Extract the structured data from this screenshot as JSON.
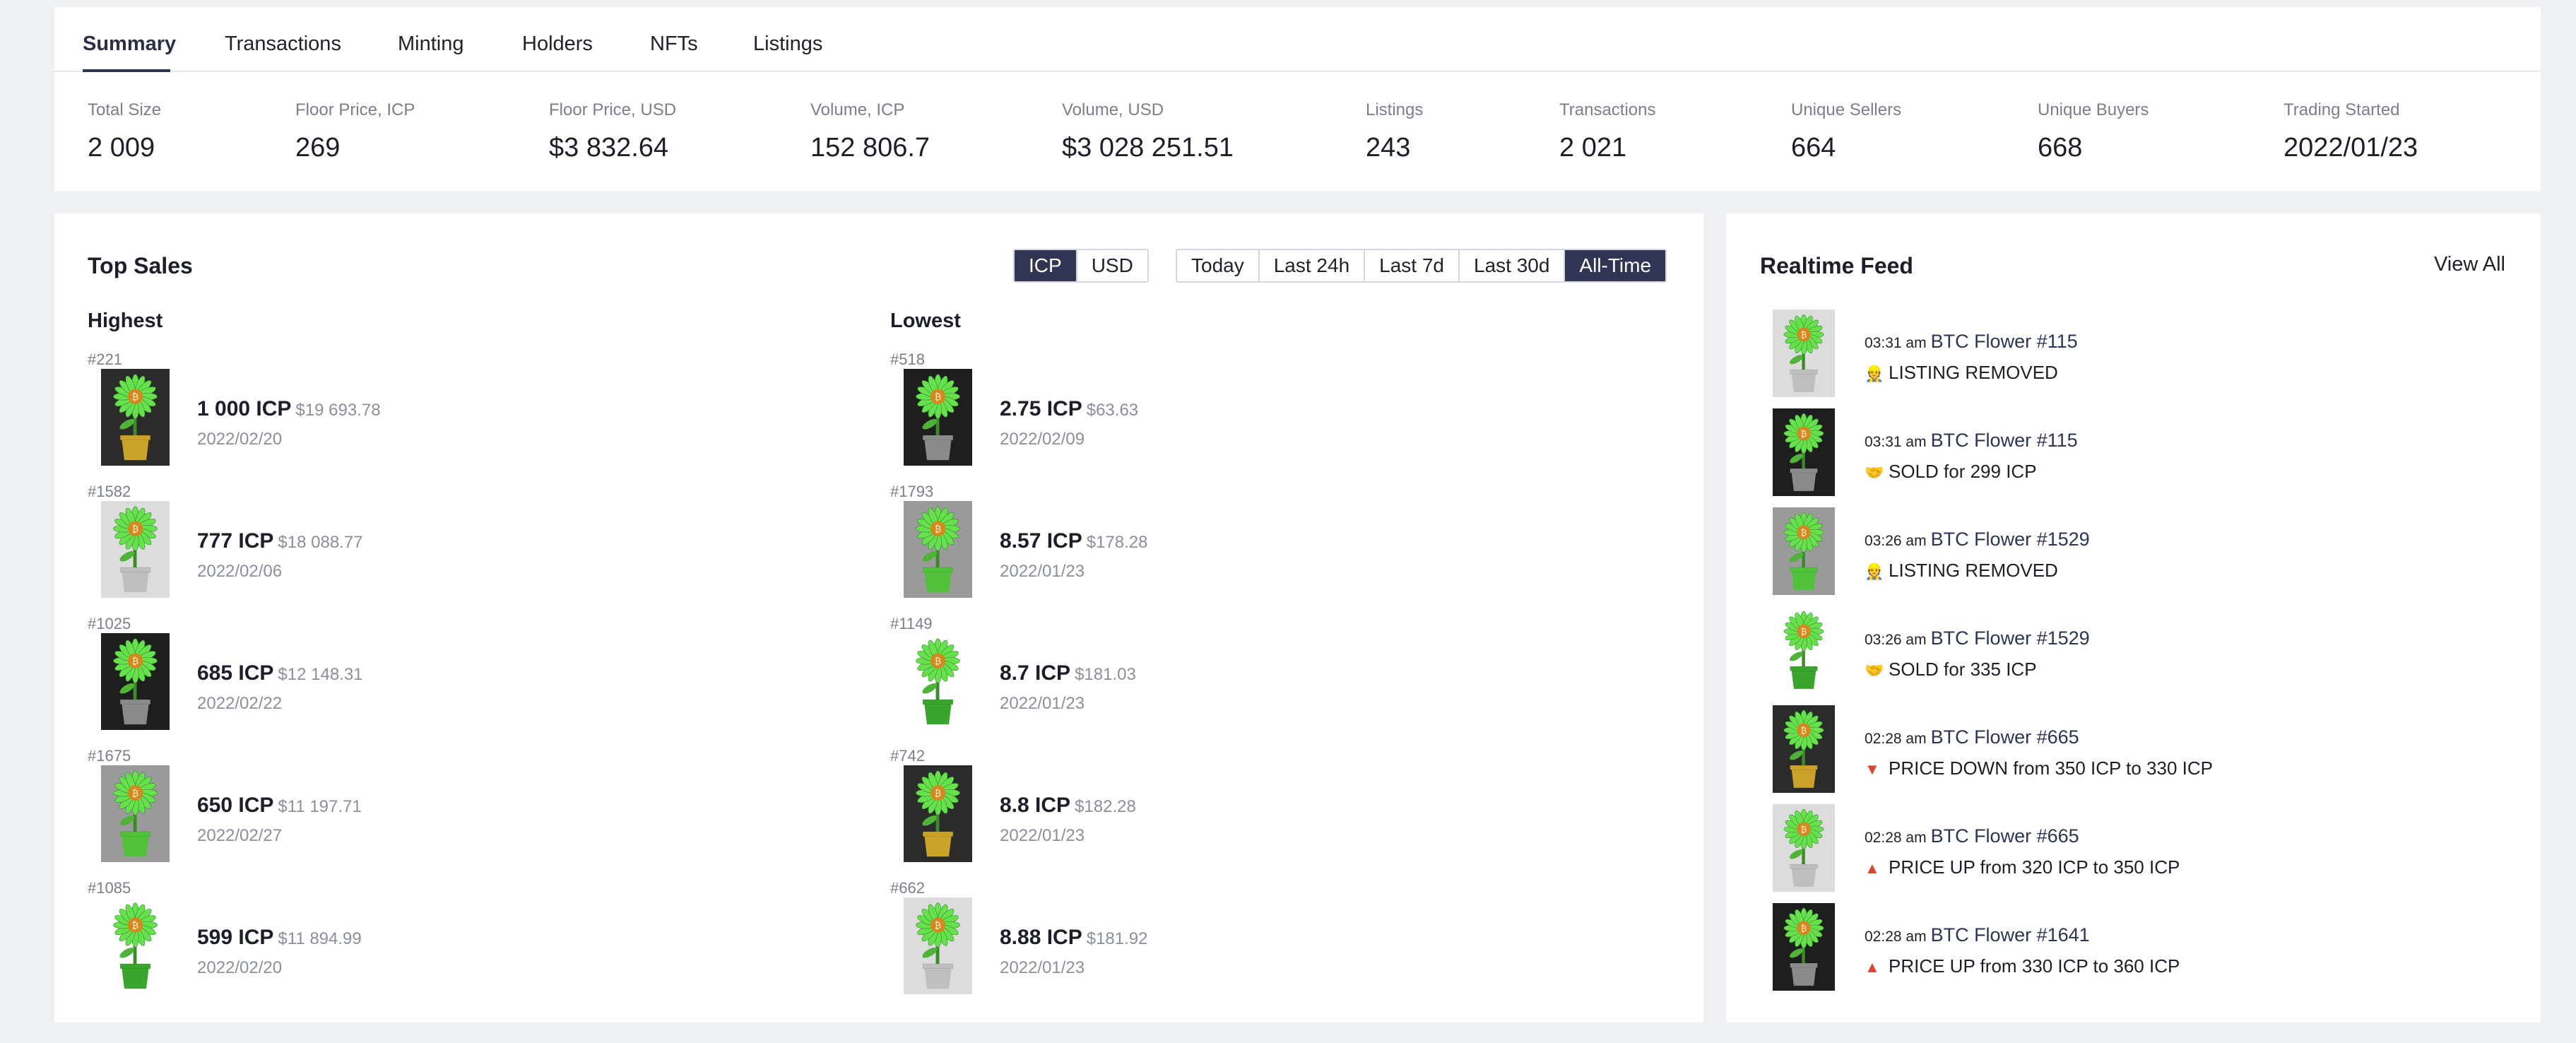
{
  "tabs": [
    {
      "label": "Summary",
      "active": true
    },
    {
      "label": "Transactions"
    },
    {
      "label": "Minting"
    },
    {
      "label": "Holders"
    },
    {
      "label": "NFTs"
    },
    {
      "label": "Listings"
    }
  ],
  "stats": [
    {
      "label": "Total Size",
      "value": "2 009"
    },
    {
      "label": "Floor Price, ICP",
      "value": "269"
    },
    {
      "label": "Floor Price, USD",
      "value": "$3 832.64"
    },
    {
      "label": "Volume, ICP",
      "value": "152 806.7"
    },
    {
      "label": "Volume, USD",
      "value": "$3 028 251.51"
    },
    {
      "label": "Listings",
      "value": "243"
    },
    {
      "label": "Transactions",
      "value": "2 021"
    },
    {
      "label": "Unique Sellers",
      "value": "664"
    },
    {
      "label": "Unique Buyers",
      "value": "668"
    },
    {
      "label": "Trading Started",
      "value": "2022/01/23"
    }
  ],
  "top_sales": {
    "title": "Top Sales",
    "currency_options": [
      "ICP",
      "USD"
    ],
    "currency_selected": "ICP",
    "period_options": [
      "Today",
      "Last 24h",
      "Last 7d",
      "Last 30d",
      "All-Time"
    ],
    "period_selected": "All-Time",
    "highest_label": "Highest",
    "lowest_label": "Lowest",
    "highest": [
      {
        "id": "#221",
        "price": "1 000 ICP",
        "usd": "$19 693.78",
        "date": "2022/02/20"
      },
      {
        "id": "#1582",
        "price": "777 ICP",
        "usd": "$18 088.77",
        "date": "2022/02/06"
      },
      {
        "id": "#1025",
        "price": "685 ICP",
        "usd": "$12 148.31",
        "date": "2022/02/22"
      },
      {
        "id": "#1675",
        "price": "650 ICP",
        "usd": "$11 197.71",
        "date": "2022/02/27"
      },
      {
        "id": "#1085",
        "price": "599 ICP",
        "usd": "$11 894.99",
        "date": "2022/02/20"
      }
    ],
    "lowest": [
      {
        "id": "#518",
        "price": "2.75 ICP",
        "usd": "$63.63",
        "date": "2022/02/09"
      },
      {
        "id": "#1793",
        "price": "8.57 ICP",
        "usd": "$178.28",
        "date": "2022/01/23"
      },
      {
        "id": "#1149",
        "price": "8.7 ICP",
        "usd": "$181.03",
        "date": "2022/01/23"
      },
      {
        "id": "#742",
        "price": "8.8 ICP",
        "usd": "$182.28",
        "date": "2022/01/23"
      },
      {
        "id": "#662",
        "price": "8.88 ICP",
        "usd": "$181.92",
        "date": "2022/01/23"
      }
    ]
  },
  "feed": {
    "title": "Realtime Feed",
    "view_all": "View All",
    "items": [
      {
        "time": "03:31 am",
        "name": "BTC Flower #115",
        "icon": "person-icon",
        "text": "LISTING REMOVED"
      },
      {
        "time": "03:31 am",
        "name": "BTC Flower #115",
        "icon": "handshake-icon",
        "text": "SOLD for 299 ICP"
      },
      {
        "time": "03:26 am",
        "name": "BTC Flower #1529",
        "icon": "person-icon",
        "text": "LISTING REMOVED"
      },
      {
        "time": "03:26 am",
        "name": "BTC Flower #1529",
        "icon": "handshake-icon",
        "text": "SOLD for 335 ICP"
      },
      {
        "time": "02:28 am",
        "name": "BTC Flower #665",
        "icon": "triangle-down-icon",
        "text": "PRICE DOWN from 350 ICP to 330 ICP"
      },
      {
        "time": "02:28 am",
        "name": "BTC Flower #665",
        "icon": "triangle-up-icon",
        "text": "PRICE UP from 320 ICP to 350 ICP"
      },
      {
        "time": "02:28 am",
        "name": "BTC Flower #1641",
        "icon": "triangle-up-icon",
        "text": "PRICE UP from 330 ICP to 360 ICP"
      }
    ]
  },
  "colors": {
    "accent_dark": "#2f3552",
    "page_bg": "#eef0f4",
    "flower_green": "#5fd84a",
    "price_down": "#e2432d",
    "price_up": "#e2432d"
  }
}
